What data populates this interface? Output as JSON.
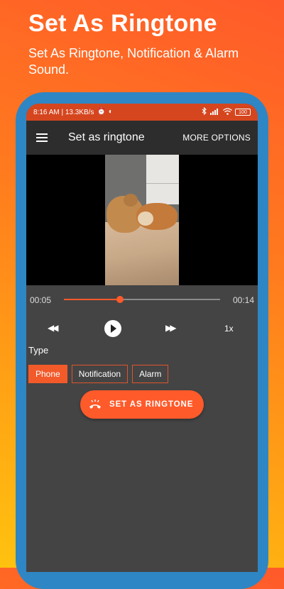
{
  "promo": {
    "title": "Set As Ringtone",
    "subtitle": "Set As Ringtone, Notification & Alarm Sound."
  },
  "status_bar": {
    "time_speed": "8:16 AM | 13.3KB/s",
    "battery": "100",
    "color": "#d5461f"
  },
  "toolbar": {
    "title": "Set as ringtone",
    "more_options": "MORE OPTIONS"
  },
  "player": {
    "elapsed": "00:05",
    "total": "00:14",
    "progress_fraction": 0.36,
    "speed": "1x"
  },
  "type_section": {
    "label": "Type",
    "options": [
      "Phone",
      "Notification",
      "Alarm"
    ],
    "selected": "Phone"
  },
  "cta": {
    "label": "SET AS RINGTONE"
  },
  "colors": {
    "accent": "#ff5a2a",
    "frame": "#2f86c4",
    "screen_bg": "#444444",
    "toolbar_bg": "#2d2d2d"
  },
  "icons": [
    "menu-icon",
    "rewind-icon",
    "play-icon",
    "fast-forward-icon",
    "phone-ring-icon",
    "alarm-clock-icon",
    "bluetooth-icon",
    "signal-icon",
    "wifi-icon",
    "battery-icon"
  ]
}
